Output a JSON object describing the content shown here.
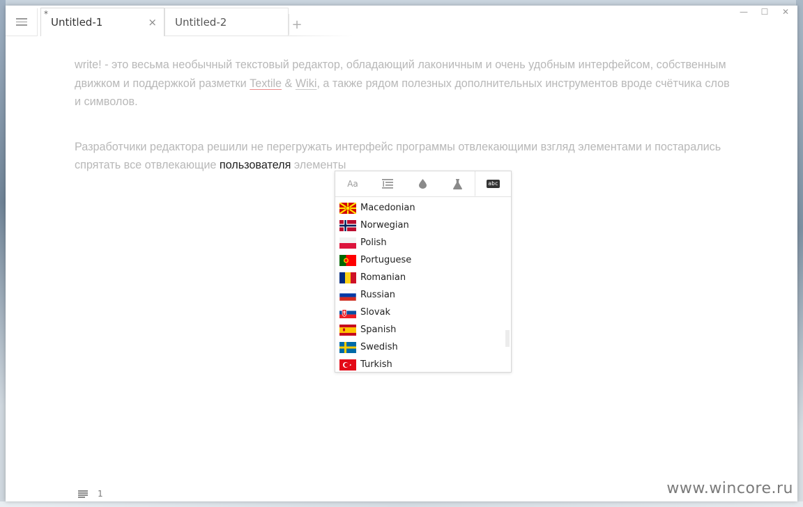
{
  "tabs": [
    {
      "label": "Untitled-1",
      "modified_marker": "*",
      "close": "×"
    },
    {
      "label": "Untitled-2"
    }
  ],
  "tab_add": "+",
  "window_controls": {
    "minimize": "—",
    "maximize": "☐",
    "close": "✕"
  },
  "editor": {
    "p1_a": "write! - это весьма необычный текстовый редактор, обладающий лаконичным и очень удобным интерфейсом, собственным движком и поддержкой разметки ",
    "p1_link1": "Textile",
    "p1_amp": " & ",
    "p1_link2": "Wiki",
    "p1_b": ", а также рядом полезных дополнительных инструментов вроде счётчика слов и символов.",
    "p2_a": "Разработчики редактора решили не перегружать интерфейс программы отвлекающими взгляд элементами и постарались спрятать все отвлекающие ",
    "p2_highlight": "пользователя",
    "p2_b": " элементы"
  },
  "popup": {
    "tabs": [
      {
        "icon": "font-size-icon",
        "text": "Aa"
      },
      {
        "icon": "line-spacing-icon"
      },
      {
        "icon": "color-drop-icon"
      },
      {
        "icon": "flask-icon"
      },
      {
        "icon": "spellcheck-abc-icon",
        "text": "abc",
        "active": true
      }
    ],
    "languages": [
      {
        "name": "Macedonian",
        "flag": "mk"
      },
      {
        "name": "Norwegian",
        "flag": "no"
      },
      {
        "name": "Polish",
        "flag": "pl"
      },
      {
        "name": "Portuguese",
        "flag": "pt"
      },
      {
        "name": "Romanian",
        "flag": "ro"
      },
      {
        "name": "Russian",
        "flag": "ru"
      },
      {
        "name": "Slovak",
        "flag": "sk"
      },
      {
        "name": "Spanish",
        "flag": "es"
      },
      {
        "name": "Swedish",
        "flag": "se"
      },
      {
        "name": "Turkish",
        "flag": "tr"
      }
    ]
  },
  "status": {
    "line": "1"
  },
  "watermark": "www.wincore.ru",
  "colors": {
    "text_faded": "#b8b8b8",
    "text_highlight": "#222222",
    "spell_underline": "#e98b8b"
  }
}
